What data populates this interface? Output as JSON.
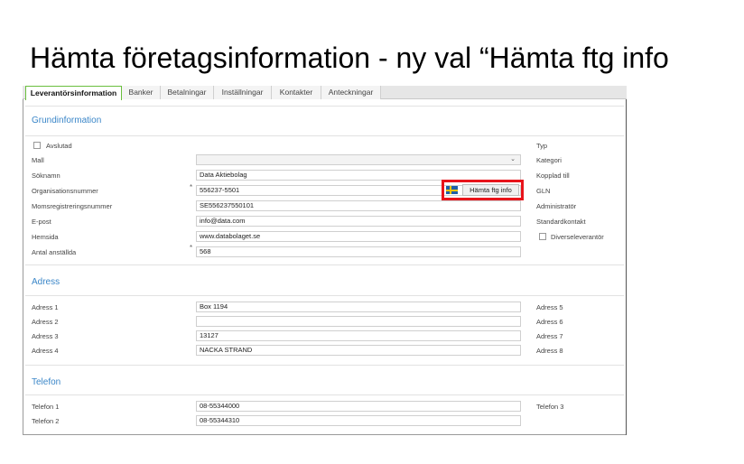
{
  "title": "Hämta företagsinformation - ny val “Hämta ftg info",
  "tabs": [
    "Leverantörsinformation",
    "Banker",
    "Betalningar",
    "Inställningar",
    "Kontakter",
    "Anteckningar"
  ],
  "grund": {
    "header": "Grundinformation",
    "avslutad": "Avslutad",
    "rows": [
      {
        "label": "Mall",
        "value": ""
      },
      {
        "label": "Söknamn",
        "value": "Data  Aktiebolag"
      },
      {
        "label": "Organisationsnummer",
        "value": "556237-5501"
      },
      {
        "label": "Momsregistreringsnummer",
        "value": "SE556237550101"
      },
      {
        "label": "E-post",
        "value": "info@data.com"
      },
      {
        "label": "Hemsida",
        "value": "www.databolaget.se"
      },
      {
        "label": "Antal anställda",
        "value": "568"
      }
    ],
    "required": "*",
    "fetch_button": "Hämta ftg info",
    "flag": "sweden-flag-icon",
    "right": [
      "Typ",
      "Kategori",
      "Kopplad till",
      "GLN",
      "Administratör",
      "Standardkontakt",
      "Diverseleverantör"
    ],
    "highlight_color": "#e8141b"
  },
  "adress": {
    "header": "Adress",
    "rows": [
      {
        "label": "Adress 1",
        "value": "Box 1194"
      },
      {
        "label": "Adress 2",
        "value": ""
      },
      {
        "label": "Adress 3",
        "value": "13127"
      },
      {
        "label": "Adress 4",
        "value": "NACKA STRAND"
      }
    ],
    "right": [
      "Adress 5",
      "Adress 6",
      "Adress 7",
      "Adress 8"
    ]
  },
  "telefon": {
    "header": "Telefon",
    "rows": [
      {
        "label": "Telefon 1",
        "value": "08-55344000"
      },
      {
        "label": "Telefon 2",
        "value": "08-55344310"
      }
    ],
    "right": [
      "Telefon 3"
    ]
  }
}
